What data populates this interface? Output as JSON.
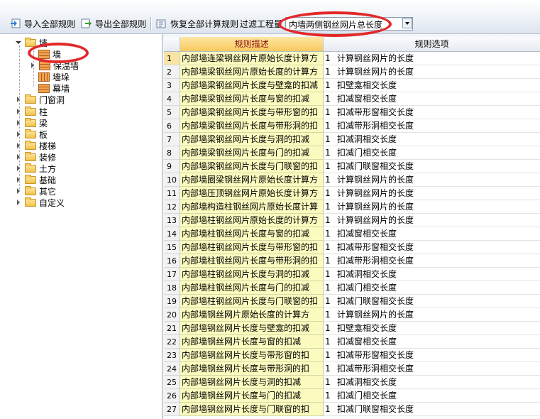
{
  "toolbar": {
    "import_label": "导入全部规则",
    "export_label": "导出全部规则",
    "restore_label": "恢复全部计算规则",
    "filter_label": "过滤工程量",
    "filter_value": "内墙两侧钢丝网片总长度"
  },
  "tree": {
    "root_label": "墙",
    "children": [
      "墙",
      "保温墙",
      "墙垛",
      "幕墙"
    ],
    "categories": [
      "门窗洞",
      "柱",
      "梁",
      "板",
      "楼梯",
      "装修",
      "土方",
      "基础",
      "其它",
      "自定义"
    ]
  },
  "grid": {
    "headers": [
      "规则描述",
      "规则选项"
    ],
    "rows": [
      {
        "num": "1",
        "desc": "内部墙连梁钢丝网片原始长度计算方",
        "val": "1",
        "opt": "计算钢丝网片的长度"
      },
      {
        "num": "2",
        "desc": "内部墙梁钢丝网片原始长度的计算方",
        "val": "1",
        "opt": "计算钢丝网片的长度"
      },
      {
        "num": "3",
        "desc": "内部墙梁钢丝网片长度与壁龛的扣减",
        "val": "1",
        "opt": "扣壁龛相交长度"
      },
      {
        "num": "4",
        "desc": "内部墙梁钢丝网片长度与窗的扣减",
        "val": "1",
        "opt": "扣减窗相交长度"
      },
      {
        "num": "5",
        "desc": "内部墙梁钢丝网片长度与带形窗的扣",
        "val": "1",
        "opt": "扣减带形窗相交长度"
      },
      {
        "num": "6",
        "desc": "内部墙梁钢丝网片长度与带形洞的扣",
        "val": "1",
        "opt": "扣减带形洞相交长度"
      },
      {
        "num": "7",
        "desc": "内部墙梁钢丝网片长度与洞的扣减",
        "val": "1",
        "opt": "扣减洞相交长度"
      },
      {
        "num": "8",
        "desc": "内部墙梁钢丝网片长度与门的扣减",
        "val": "1",
        "opt": "扣减门相交长度"
      },
      {
        "num": "9",
        "desc": "内部墙梁钢丝网片长度与门联窗的扣",
        "val": "1",
        "opt": "扣减门联窗相交长度"
      },
      {
        "num": "10",
        "desc": "内部墙圈梁钢丝网片原始长度计算方",
        "val": "1",
        "opt": "计算钢丝网片的长度"
      },
      {
        "num": "11",
        "desc": "内部墙压顶钢丝网片原始长度计算方",
        "val": "1",
        "opt": "计算钢丝网片的长度"
      },
      {
        "num": "12",
        "desc": "内部墙构造柱钢丝网片原始长度计算",
        "val": "1",
        "opt": "计算钢丝网片的长度"
      },
      {
        "num": "13",
        "desc": "内部墙柱钢丝网片原始长度的计算方",
        "val": "1",
        "opt": "计算钢丝网片的长度"
      },
      {
        "num": "14",
        "desc": "内部墙柱钢丝网片长度与窗的扣减",
        "val": "1",
        "opt": "扣减窗相交长度"
      },
      {
        "num": "15",
        "desc": "内部墙柱钢丝网片长度与带形窗的扣",
        "val": "1",
        "opt": "扣减带形窗相交长度"
      },
      {
        "num": "16",
        "desc": "内部墙柱钢丝网片长度与带形洞的扣",
        "val": "1",
        "opt": "扣减带形洞相交长度"
      },
      {
        "num": "17",
        "desc": "内部墙柱钢丝网片长度与洞的扣减",
        "val": "1",
        "opt": "扣减洞相交长度"
      },
      {
        "num": "18",
        "desc": "内部墙柱钢丝网片长度与门的扣减",
        "val": "1",
        "opt": "扣减门相交长度"
      },
      {
        "num": "19",
        "desc": "内部墙柱钢丝网片长度与门联窗的扣",
        "val": "1",
        "opt": "扣减门联窗相交长度"
      },
      {
        "num": "20",
        "desc": "内部墙钢丝网片原始长度的计算方",
        "val": "1",
        "opt": "计算钢丝网片的长度"
      },
      {
        "num": "21",
        "desc": "内部墙钢丝网片长度与壁龛的扣减",
        "val": "1",
        "opt": "扣壁龛相交长度"
      },
      {
        "num": "22",
        "desc": "内部墙钢丝网片长度与窗的扣减",
        "val": "1",
        "opt": "扣减窗相交长度"
      },
      {
        "num": "23",
        "desc": "内部墙钢丝网片长度与带形窗的扣",
        "val": "1",
        "opt": "扣减带形窗相交长度"
      },
      {
        "num": "24",
        "desc": "内部墙钢丝网片长度与带形洞的扣",
        "val": "1",
        "opt": "扣减带形洞相交长度"
      },
      {
        "num": "25",
        "desc": "内部墙钢丝网片长度与洞的扣减",
        "val": "1",
        "opt": "扣减洞相交长度"
      },
      {
        "num": "26",
        "desc": "内部墙钢丝网片长度与门的扣减",
        "val": "1",
        "opt": "扣减门相交长度"
      },
      {
        "num": "27",
        "desc": "内部墙钢丝网片长度与门联窗的扣",
        "val": "1",
        "opt": "扣减门联窗相交长度"
      }
    ]
  },
  "colors": {
    "annotation": "#e3282a",
    "desc_bg": "#fbfbbf",
    "header_active": "#f8c95e"
  }
}
